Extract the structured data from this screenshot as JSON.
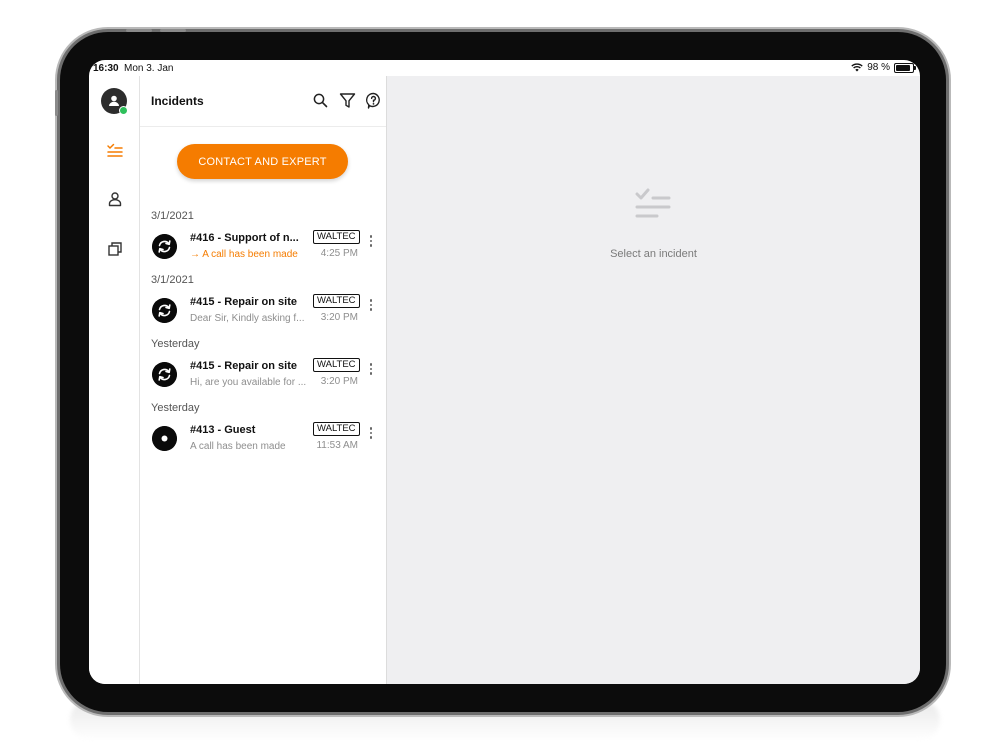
{
  "status_bar": {
    "time": "16:30",
    "date": "Mon 3. Jan",
    "battery": "98 %"
  },
  "header": {
    "title": "Incidents"
  },
  "cta": {
    "label": "CONTACT AND EXPERT"
  },
  "icons": {
    "rail": [
      "avatar-icon",
      "incidents-icon",
      "contacts-icon",
      "windows-icon"
    ],
    "header": [
      "search-icon",
      "filter-icon",
      "help-icon"
    ]
  },
  "colors": {
    "accent": "#f57c00",
    "online": "#2ec05b",
    "detail_bg": "#efeff1"
  },
  "groups": [
    {
      "date": "3/1/2021",
      "item": {
        "title": "#416 - Support of n...",
        "subtitle": "→ A call has been made",
        "badge": "WALTEC",
        "time": "4:25 PM",
        "icon": "refresh-icon",
        "highlight": true
      }
    },
    {
      "date": "3/1/2021",
      "item": {
        "title": "#415 - Repair on site",
        "subtitle": "Dear Sir, Kindly asking f...",
        "badge": "WALTEC",
        "time": "3:20 PM",
        "icon": "refresh-icon",
        "highlight": false
      }
    },
    {
      "date": "Yesterday",
      "item": {
        "title": "#415 - Repair on site",
        "subtitle": "Hi, are you available for ...",
        "badge": "WALTEC",
        "time": "3:20 PM",
        "icon": "refresh-icon",
        "highlight": false
      }
    },
    {
      "date": "Yesterday",
      "item": {
        "title": "#413 - Guest",
        "subtitle": "A call has been made",
        "badge": "WALTEC",
        "time": "11:53 AM",
        "icon": "dot-icon",
        "highlight": false
      }
    }
  ],
  "detail": {
    "empty_text": "Select an incident",
    "icon": "incidents-empty-icon"
  }
}
